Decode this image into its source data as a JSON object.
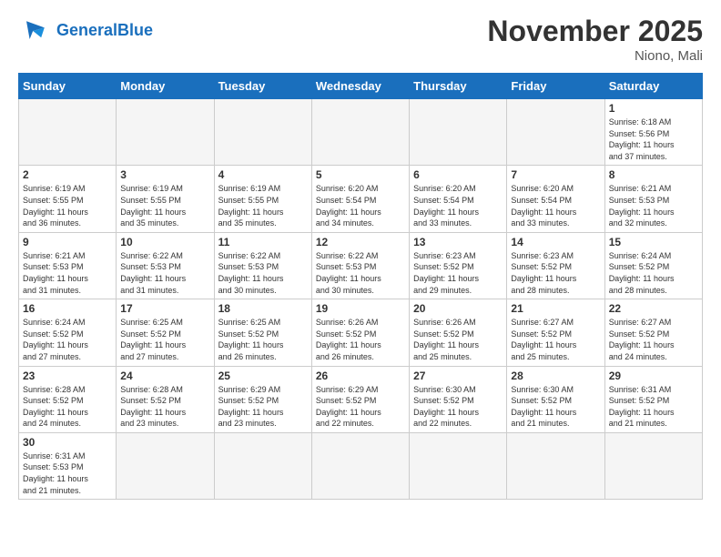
{
  "header": {
    "logo_general": "General",
    "logo_blue": "Blue",
    "month_title": "November 2025",
    "location": "Niono, Mali"
  },
  "weekdays": [
    "Sunday",
    "Monday",
    "Tuesday",
    "Wednesday",
    "Thursday",
    "Friday",
    "Saturday"
  ],
  "days": [
    {
      "date": "",
      "empty": true
    },
    {
      "date": "",
      "empty": true
    },
    {
      "date": "",
      "empty": true
    },
    {
      "date": "",
      "empty": true
    },
    {
      "date": "",
      "empty": true
    },
    {
      "date": "",
      "empty": true
    },
    {
      "date": "1",
      "sunrise": "6:18 AM",
      "sunset": "5:56 PM",
      "daylight_hours": "11 hours",
      "daylight_minutes": "37 minutes."
    },
    {
      "date": "2",
      "sunrise": "6:19 AM",
      "sunset": "5:55 PM",
      "daylight_hours": "11 hours",
      "daylight_minutes": "36 minutes."
    },
    {
      "date": "3",
      "sunrise": "6:19 AM",
      "sunset": "5:55 PM",
      "daylight_hours": "11 hours",
      "daylight_minutes": "35 minutes."
    },
    {
      "date": "4",
      "sunrise": "6:19 AM",
      "sunset": "5:55 PM",
      "daylight_hours": "11 hours",
      "daylight_minutes": "35 minutes."
    },
    {
      "date": "5",
      "sunrise": "6:20 AM",
      "sunset": "5:54 PM",
      "daylight_hours": "11 hours",
      "daylight_minutes": "34 minutes."
    },
    {
      "date": "6",
      "sunrise": "6:20 AM",
      "sunset": "5:54 PM",
      "daylight_hours": "11 hours",
      "daylight_minutes": "33 minutes."
    },
    {
      "date": "7",
      "sunrise": "6:20 AM",
      "sunset": "5:54 PM",
      "daylight_hours": "11 hours",
      "daylight_minutes": "33 minutes."
    },
    {
      "date": "8",
      "sunrise": "6:21 AM",
      "sunset": "5:53 PM",
      "daylight_hours": "11 hours",
      "daylight_minutes": "32 minutes."
    },
    {
      "date": "9",
      "sunrise": "6:21 AM",
      "sunset": "5:53 PM",
      "daylight_hours": "11 hours",
      "daylight_minutes": "31 minutes."
    },
    {
      "date": "10",
      "sunrise": "6:22 AM",
      "sunset": "5:53 PM",
      "daylight_hours": "11 hours",
      "daylight_minutes": "31 minutes."
    },
    {
      "date": "11",
      "sunrise": "6:22 AM",
      "sunset": "5:53 PM",
      "daylight_hours": "11 hours",
      "daylight_minutes": "30 minutes."
    },
    {
      "date": "12",
      "sunrise": "6:22 AM",
      "sunset": "5:53 PM",
      "daylight_hours": "11 hours",
      "daylight_minutes": "30 minutes."
    },
    {
      "date": "13",
      "sunrise": "6:23 AM",
      "sunset": "5:52 PM",
      "daylight_hours": "11 hours",
      "daylight_minutes": "29 minutes."
    },
    {
      "date": "14",
      "sunrise": "6:23 AM",
      "sunset": "5:52 PM",
      "daylight_hours": "11 hours",
      "daylight_minutes": "28 minutes."
    },
    {
      "date": "15",
      "sunrise": "6:24 AM",
      "sunset": "5:52 PM",
      "daylight_hours": "11 hours",
      "daylight_minutes": "28 minutes."
    },
    {
      "date": "16",
      "sunrise": "6:24 AM",
      "sunset": "5:52 PM",
      "daylight_hours": "11 hours",
      "daylight_minutes": "27 minutes."
    },
    {
      "date": "17",
      "sunrise": "6:25 AM",
      "sunset": "5:52 PM",
      "daylight_hours": "11 hours",
      "daylight_minutes": "27 minutes."
    },
    {
      "date": "18",
      "sunrise": "6:25 AM",
      "sunset": "5:52 PM",
      "daylight_hours": "11 hours",
      "daylight_minutes": "26 minutes."
    },
    {
      "date": "19",
      "sunrise": "6:26 AM",
      "sunset": "5:52 PM",
      "daylight_hours": "11 hours",
      "daylight_minutes": "26 minutes."
    },
    {
      "date": "20",
      "sunrise": "6:26 AM",
      "sunset": "5:52 PM",
      "daylight_hours": "11 hours",
      "daylight_minutes": "25 minutes."
    },
    {
      "date": "21",
      "sunrise": "6:27 AM",
      "sunset": "5:52 PM",
      "daylight_hours": "11 hours",
      "daylight_minutes": "25 minutes."
    },
    {
      "date": "22",
      "sunrise": "6:27 AM",
      "sunset": "5:52 PM",
      "daylight_hours": "11 hours",
      "daylight_minutes": "24 minutes."
    },
    {
      "date": "23",
      "sunrise": "6:28 AM",
      "sunset": "5:52 PM",
      "daylight_hours": "11 hours",
      "daylight_minutes": "24 minutes."
    },
    {
      "date": "24",
      "sunrise": "6:28 AM",
      "sunset": "5:52 PM",
      "daylight_hours": "11 hours",
      "daylight_minutes": "23 minutes."
    },
    {
      "date": "25",
      "sunrise": "6:29 AM",
      "sunset": "5:52 PM",
      "daylight_hours": "11 hours",
      "daylight_minutes": "23 minutes."
    },
    {
      "date": "26",
      "sunrise": "6:29 AM",
      "sunset": "5:52 PM",
      "daylight_hours": "11 hours",
      "daylight_minutes": "22 minutes."
    },
    {
      "date": "27",
      "sunrise": "6:30 AM",
      "sunset": "5:52 PM",
      "daylight_hours": "11 hours",
      "daylight_minutes": "22 minutes."
    },
    {
      "date": "28",
      "sunrise": "6:30 AM",
      "sunset": "5:52 PM",
      "daylight_hours": "11 hours",
      "daylight_minutes": "21 minutes."
    },
    {
      "date": "29",
      "sunrise": "6:31 AM",
      "sunset": "5:52 PM",
      "daylight_hours": "11 hours",
      "daylight_minutes": "21 minutes."
    },
    {
      "date": "30",
      "sunrise": "6:31 AM",
      "sunset": "5:53 PM",
      "daylight_hours": "11 hours",
      "daylight_minutes": "21 minutes."
    },
    {
      "date": "",
      "empty": true
    },
    {
      "date": "",
      "empty": true
    },
    {
      "date": "",
      "empty": true
    },
    {
      "date": "",
      "empty": true
    },
    {
      "date": "",
      "empty": true
    },
    {
      "date": "",
      "empty": true
    }
  ]
}
